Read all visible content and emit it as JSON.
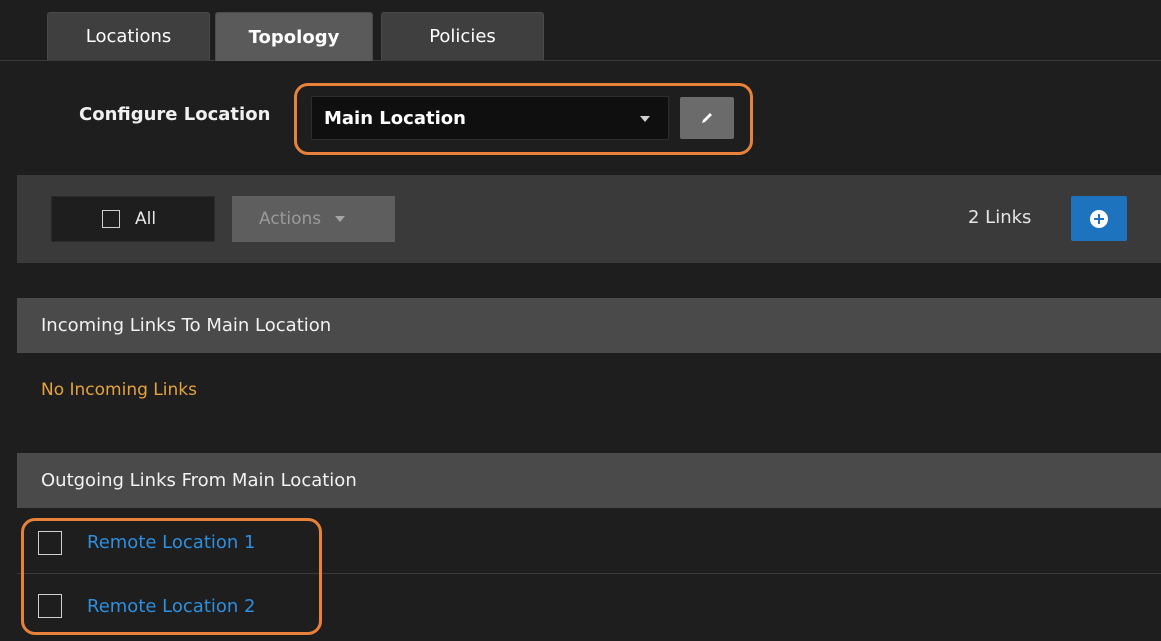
{
  "tabs": [
    {
      "label": "Locations"
    },
    {
      "label": "Topology",
      "active": true
    },
    {
      "label": "Policies"
    }
  ],
  "configure": {
    "label": "Configure Location",
    "selected_location": "Main Location"
  },
  "toolbar": {
    "select_all_label": "All",
    "actions_label": "Actions",
    "links_count": "2 Links"
  },
  "incoming": {
    "title": "Incoming Links To Main Location",
    "empty_message": "No Incoming Links"
  },
  "outgoing": {
    "title": "Outgoing Links From Main Location",
    "links": [
      {
        "label": "Remote Location 1"
      },
      {
        "label": "Remote Location 2"
      }
    ]
  },
  "colors": {
    "highlight": "#e8823a",
    "link": "#2e8ee0",
    "empty_message": "#e6a23c",
    "primary_button": "#1e73be"
  },
  "icons": {
    "edit": "pencil-icon",
    "add": "plus-circle-icon"
  }
}
